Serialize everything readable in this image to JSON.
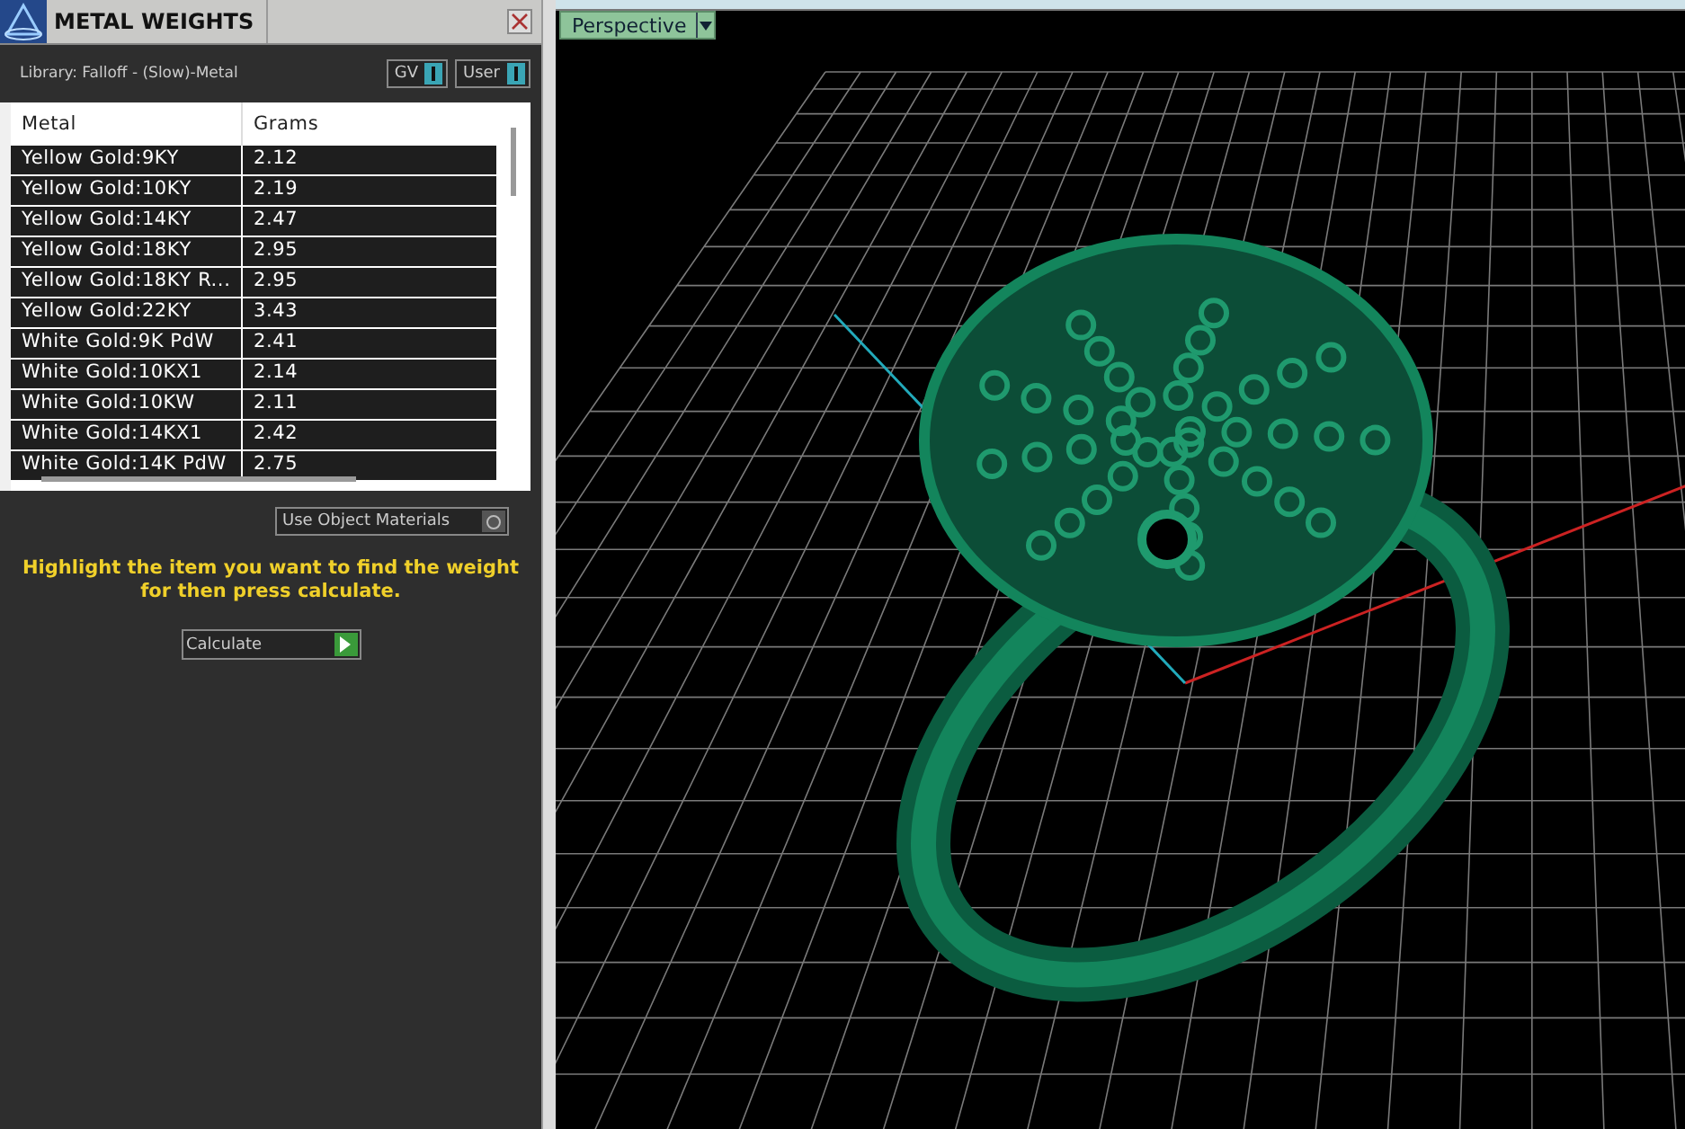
{
  "panel": {
    "title": "METAL WEIGHTS",
    "library": "Library: Falloff - (Slow)-Metal",
    "toggles": [
      {
        "label": "GV"
      },
      {
        "label": "User"
      }
    ],
    "table": {
      "columns": [
        "Metal",
        "Grams"
      ],
      "rows": [
        {
          "metal": "Yellow Gold:9KY",
          "grams": "2.12"
        },
        {
          "metal": "Yellow Gold:10KY",
          "grams": "2.19"
        },
        {
          "metal": "Yellow Gold:14KY",
          "grams": "2.47"
        },
        {
          "metal": "Yellow Gold:18KY",
          "grams": "2.95"
        },
        {
          "metal": "Yellow Gold:18KY R...",
          "grams": "2.95"
        },
        {
          "metal": "Yellow Gold:22KY",
          "grams": "3.43"
        },
        {
          "metal": "White Gold:9K PdW",
          "grams": "2.41"
        },
        {
          "metal": "White Gold:10KX1",
          "grams": "2.14"
        },
        {
          "metal": "White Gold:10KW",
          "grams": "2.11"
        },
        {
          "metal": "White Gold:14KX1",
          "grams": "2.42"
        },
        {
          "metal": "White Gold:14K PdW",
          "grams": "2.75"
        }
      ]
    },
    "use_object_materials": "Use Object Materials",
    "instruction": "Highlight the item you want to find the weight for then press calculate.",
    "calculate_button": "Calculate"
  },
  "viewport": {
    "view_menu": "Perspective"
  }
}
